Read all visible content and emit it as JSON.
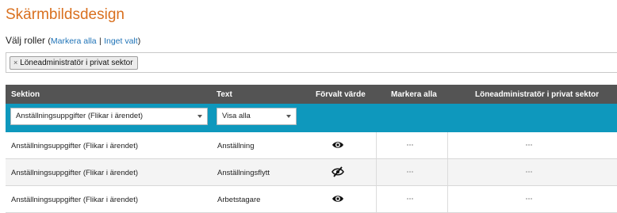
{
  "page": {
    "title": "Skärmbildsdesign"
  },
  "roles": {
    "label": "Välj roller",
    "select_all": "Markera alla",
    "separator": "|",
    "select_none": "Inget valt",
    "selected_tags": [
      "Löneadministratör i privat sektor"
    ],
    "tag_remove_glyph": "×"
  },
  "table": {
    "headers": {
      "section": "Sektion",
      "text": "Text",
      "default_value": "Förvalt värde",
      "select_all": "Markera alla",
      "role": "Löneadministratör i privat sektor"
    },
    "filters": {
      "section_value": "Anställningsuppgifter (Flikar i ärendet)",
      "text_value": "Visa alla"
    },
    "rows": [
      {
        "section": "Anställningsuppgifter (Flikar i ärendet)",
        "text": "Anställning",
        "icon": "eye-icon"
      },
      {
        "section": "Anställningsuppgifter (Flikar i ärendet)",
        "text": "Anställningsflytt",
        "icon": "eye-slash-icon"
      },
      {
        "section": "Anställningsuppgifter (Flikar i ärendet)",
        "text": "Arbetstagare",
        "icon": "eye-icon"
      }
    ]
  },
  "colors": {
    "title": "#d9701f",
    "link": "#1f73b7",
    "header_bg": "#545454",
    "filter_bg": "#0e98bd"
  }
}
